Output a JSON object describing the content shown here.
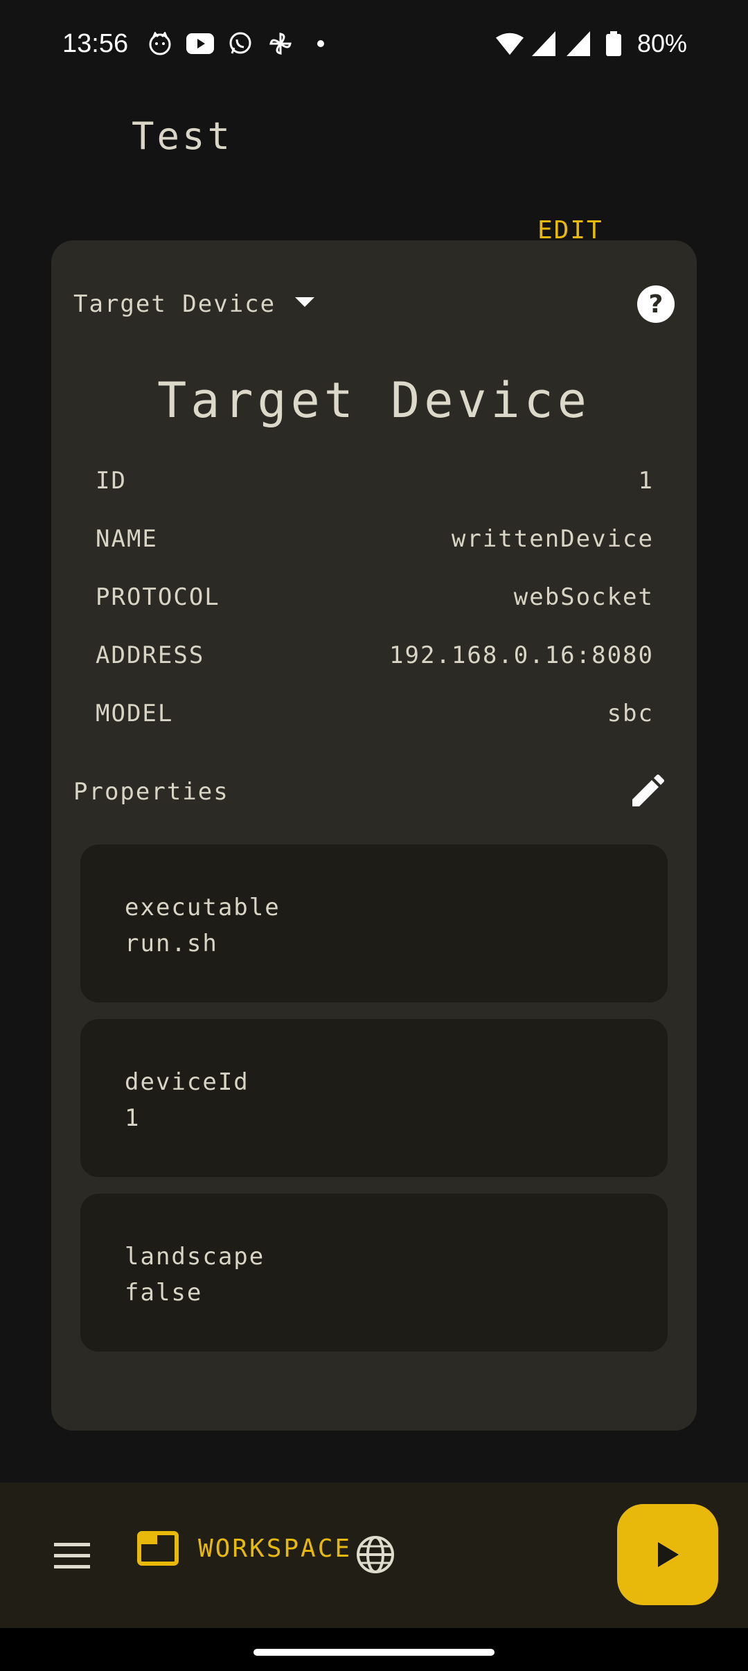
{
  "status_bar": {
    "time": "13:56",
    "notification_icons": [
      "cat-icon",
      "youtube-icon",
      "whatsapp-icon",
      "pinwheel-icon",
      "dot-icon"
    ],
    "battery": "80%"
  },
  "page": {
    "title": "Test",
    "edit_label": "EDIT"
  },
  "card": {
    "dropdown_label": "Target Device",
    "help_symbol": "?",
    "title": "Target Device",
    "info_rows": [
      {
        "key": "ID",
        "value": "1"
      },
      {
        "key": "NAME",
        "value": "writtenDevice"
      },
      {
        "key": "PROTOCOL",
        "value": "webSocket"
      },
      {
        "key": "ADDRESS",
        "value": "192.168.0.16:8080"
      },
      {
        "key": "MODEL",
        "value": "sbc"
      }
    ],
    "properties_label": "Properties",
    "properties": [
      {
        "name": "executable",
        "value": "run.sh"
      },
      {
        "name": "deviceId",
        "value": "1"
      },
      {
        "name": "landscape",
        "value": "false"
      }
    ]
  },
  "bottom_bar": {
    "workspace_label": "WORKSPACE"
  },
  "colors": {
    "accent": "#e8b90b",
    "background": "#131313",
    "card": "#2c2a24",
    "property_card": "#1e1c17",
    "bottom_bar": "#201e15"
  }
}
